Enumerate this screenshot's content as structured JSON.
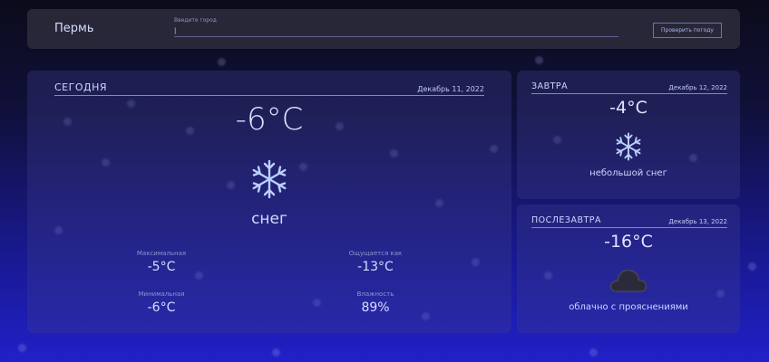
{
  "header": {
    "city": "Пермь",
    "search_label": "Введите город",
    "search_value": "|",
    "check_button": "Проверить погоду"
  },
  "today": {
    "title": "СЕГОДНЯ",
    "date": "Декабрь 11, 2022",
    "temperature": "-6°C",
    "icon": "snowflake-icon",
    "description": "снег",
    "stats": {
      "max_label": "Максимальная",
      "max_value": "-5°C",
      "feels_label": "Ощущается как",
      "feels_value": "-13°C",
      "min_label": "Минимальная",
      "min_value": "-6°C",
      "humidity_label": "Влажность",
      "humidity_value": "89%"
    }
  },
  "tomorrow": {
    "title": "ЗАВТРА",
    "date": "Декабрь 12, 2022",
    "temperature": "-4°C",
    "icon": "snowflake-icon",
    "description": "небольшой снег"
  },
  "day_after": {
    "title": "ПОСЛЕЗАВТРА",
    "date": "Декабрь 13, 2022",
    "temperature": "-16°C",
    "icon": "cloud-icon",
    "description": "облачно с прояснениями"
  },
  "colors": {
    "accent": "#c9d4ff",
    "snowflake": "#bcd0ff",
    "cloud": "#2a2a3a"
  }
}
